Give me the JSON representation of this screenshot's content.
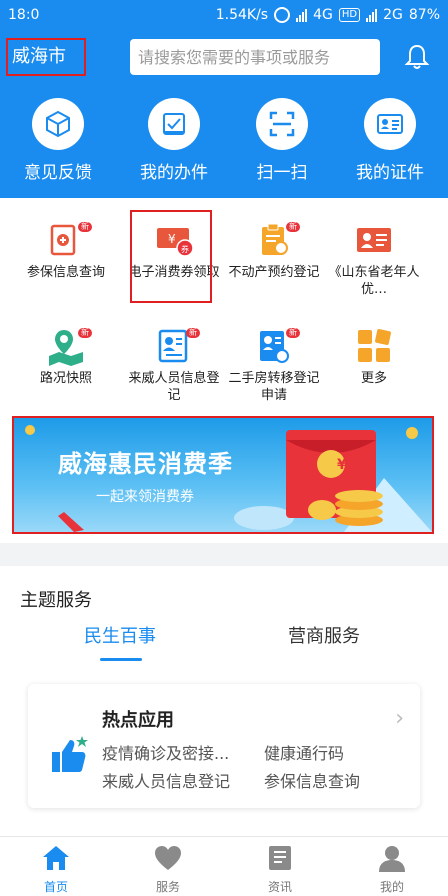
{
  "status_bar": {
    "time": "18:0",
    "speed": "1.54K/s",
    "network": "4G",
    "hd": "HD",
    "network2": "2G",
    "battery": "87%"
  },
  "header": {
    "city": "威海市",
    "search_placeholder": "请搜索您需要的事项或服务",
    "quick_actions": [
      {
        "label": "意见反馈",
        "icon": "cube-icon"
      },
      {
        "label": "我的办件",
        "icon": "checkbox-icon"
      },
      {
        "label": "扫一扫",
        "icon": "scan-icon"
      },
      {
        "label": "我的证件",
        "icon": "id-card-icon"
      }
    ]
  },
  "services": [
    {
      "label": "参保信息查询",
      "icon": "insurance-doc-icon",
      "badge": "新"
    },
    {
      "label": "电子消费券领取",
      "icon": "coupon-icon",
      "badge": ""
    },
    {
      "label": "不动产预约登记",
      "icon": "clipboard-icon",
      "badge": "新"
    },
    {
      "label": "《山东省老年人优…",
      "icon": "elder-card-icon",
      "badge": ""
    },
    {
      "label": "路况快照",
      "icon": "map-pin-icon",
      "badge": "新"
    },
    {
      "label": "来威人员信息登记",
      "icon": "person-form-icon",
      "badge": "新"
    },
    {
      "label": "二手房转移登记申请",
      "icon": "house-transfer-icon",
      "badge": "新"
    },
    {
      "label": "更多",
      "icon": "grid-more-icon",
      "badge": ""
    }
  ],
  "banner": {
    "title": "威海惠民消费季",
    "subtitle": "一起来领消费券",
    "coin_symbol": "¥"
  },
  "theme": {
    "title": "主题服务",
    "tabs": [
      "民生百事",
      "营商服务"
    ],
    "hot": {
      "title": "热点应用",
      "links": [
        "疫情确诊及密接...",
        "健康通行码",
        "来威人员信息登记",
        "参保信息查询"
      ]
    }
  },
  "tabbar": [
    {
      "label": "首页",
      "icon": "home-icon",
      "active": true
    },
    {
      "label": "服务",
      "icon": "heart-icon",
      "active": false
    },
    {
      "label": "资讯",
      "icon": "news-icon",
      "active": false
    },
    {
      "label": "我的",
      "icon": "user-icon",
      "active": false
    }
  ],
  "colors": {
    "primary": "#1a8cf0",
    "highlight_border": "#e02020",
    "badge": "#e8333b"
  }
}
